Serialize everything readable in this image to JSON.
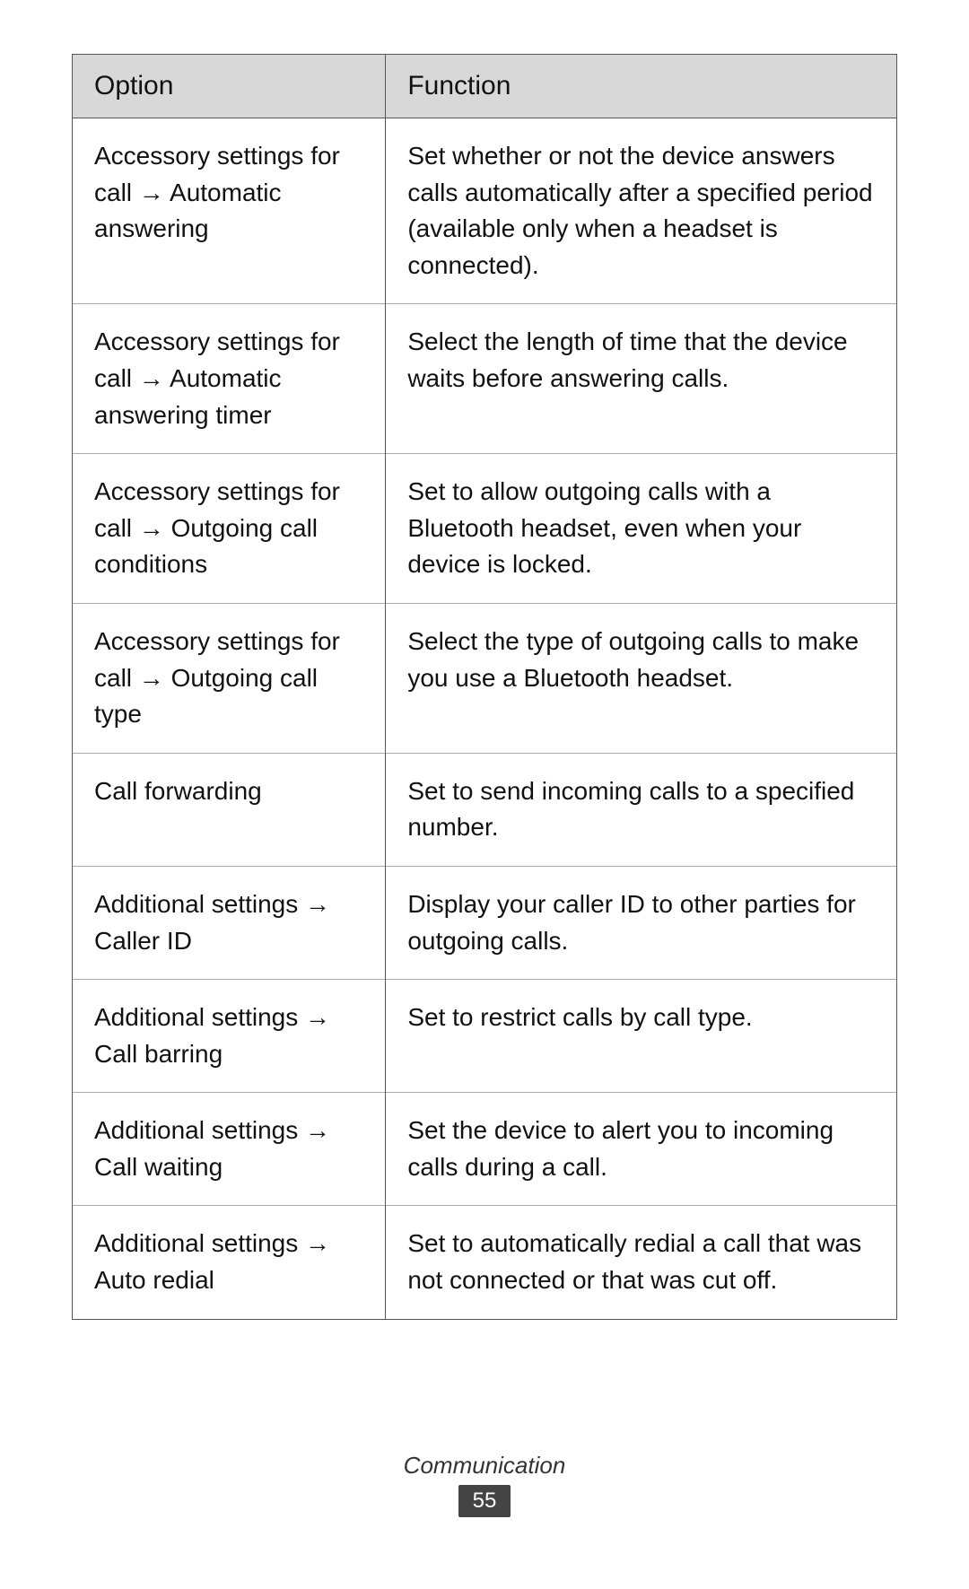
{
  "table": {
    "headers": {
      "option": "Option",
      "function": "Function"
    },
    "rows": [
      {
        "option": "Accessory settings for call → Automatic answering",
        "function": "Set whether or not the device answers calls automatically after a specified period (available only when a headset is connected)."
      },
      {
        "option": "Accessory settings for call → Automatic answering timer",
        "function": "Select the length of time that the device waits before answering calls."
      },
      {
        "option": "Accessory settings for call → Outgoing call conditions",
        "function": "Set to allow outgoing calls with a Bluetooth headset, even when your device is locked."
      },
      {
        "option": "Accessory settings for call → Outgoing call type",
        "function": "Select the type of outgoing calls to make you use a Bluetooth headset."
      },
      {
        "option": "Call forwarding",
        "function": "Set to send incoming calls to a specified number."
      },
      {
        "option": "Additional settings → Caller ID",
        "function": "Display your caller ID to other parties for outgoing calls."
      },
      {
        "option": "Additional settings → Call barring",
        "function": "Set to restrict calls by call type."
      },
      {
        "option": "Additional settings → Call waiting",
        "function": "Set the device to alert you to incoming calls during a call."
      },
      {
        "option": "Additional settings → Auto redial",
        "function": "Set to automatically redial a call that was not connected or that was cut off."
      }
    ]
  },
  "footer": {
    "label": "Communication",
    "page": "55"
  }
}
